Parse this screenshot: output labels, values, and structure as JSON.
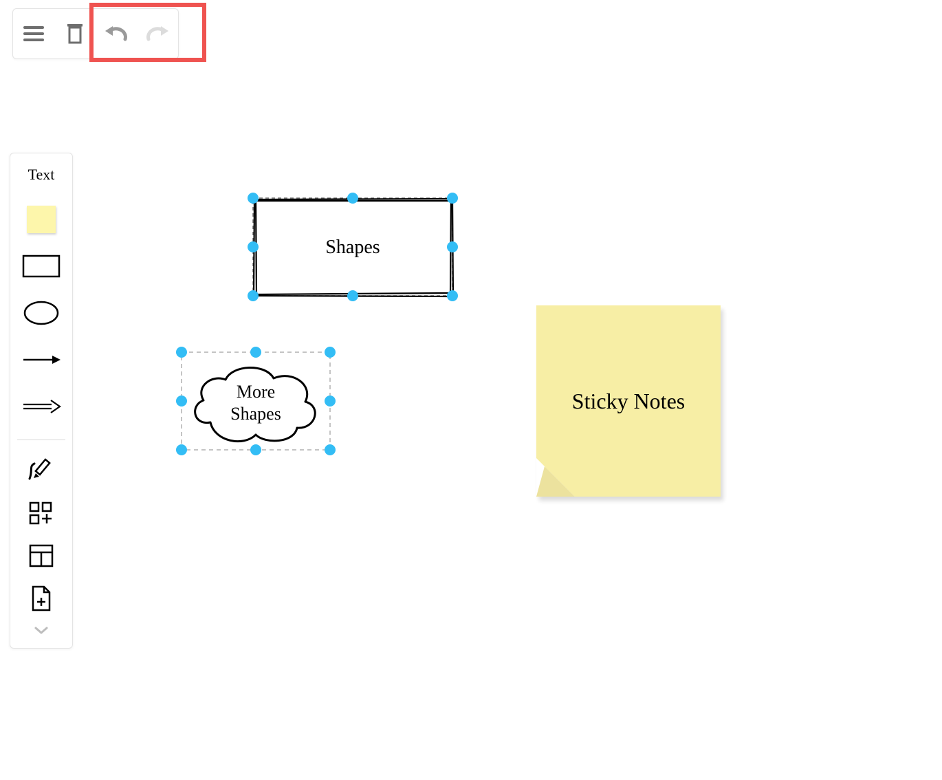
{
  "toolbar": {
    "menu_icon": "menu",
    "trash_icon": "trash",
    "undo_icon": "undo",
    "redo_icon": "redo"
  },
  "side_panel": {
    "text_tool_label": "Text",
    "tools": [
      {
        "name": "sticky-note-tool"
      },
      {
        "name": "rectangle-tool"
      },
      {
        "name": "ellipse-tool"
      },
      {
        "name": "line-arrow-tool"
      },
      {
        "name": "open-arrow-tool"
      }
    ],
    "extra_tools": [
      {
        "name": "freehand-tool",
        "icon": "pencil-squiggle"
      },
      {
        "name": "add-shape-tool",
        "icon": "grid-plus"
      },
      {
        "name": "table-tool",
        "icon": "table"
      },
      {
        "name": "add-page-tool",
        "icon": "page-plus"
      }
    ],
    "expand_icon": "chevron-down"
  },
  "canvas": {
    "rect_shape": {
      "label": "Shapes"
    },
    "cloud_shape": {
      "line1": "More",
      "line2": "Shapes"
    },
    "sticky_note": {
      "label": "Sticky Notes"
    }
  },
  "colors": {
    "highlight": "#ef5350",
    "handle": "#33bdf5",
    "sticky_bg": "#f7eea5",
    "sticky_swatch": "#fdf6ab"
  }
}
